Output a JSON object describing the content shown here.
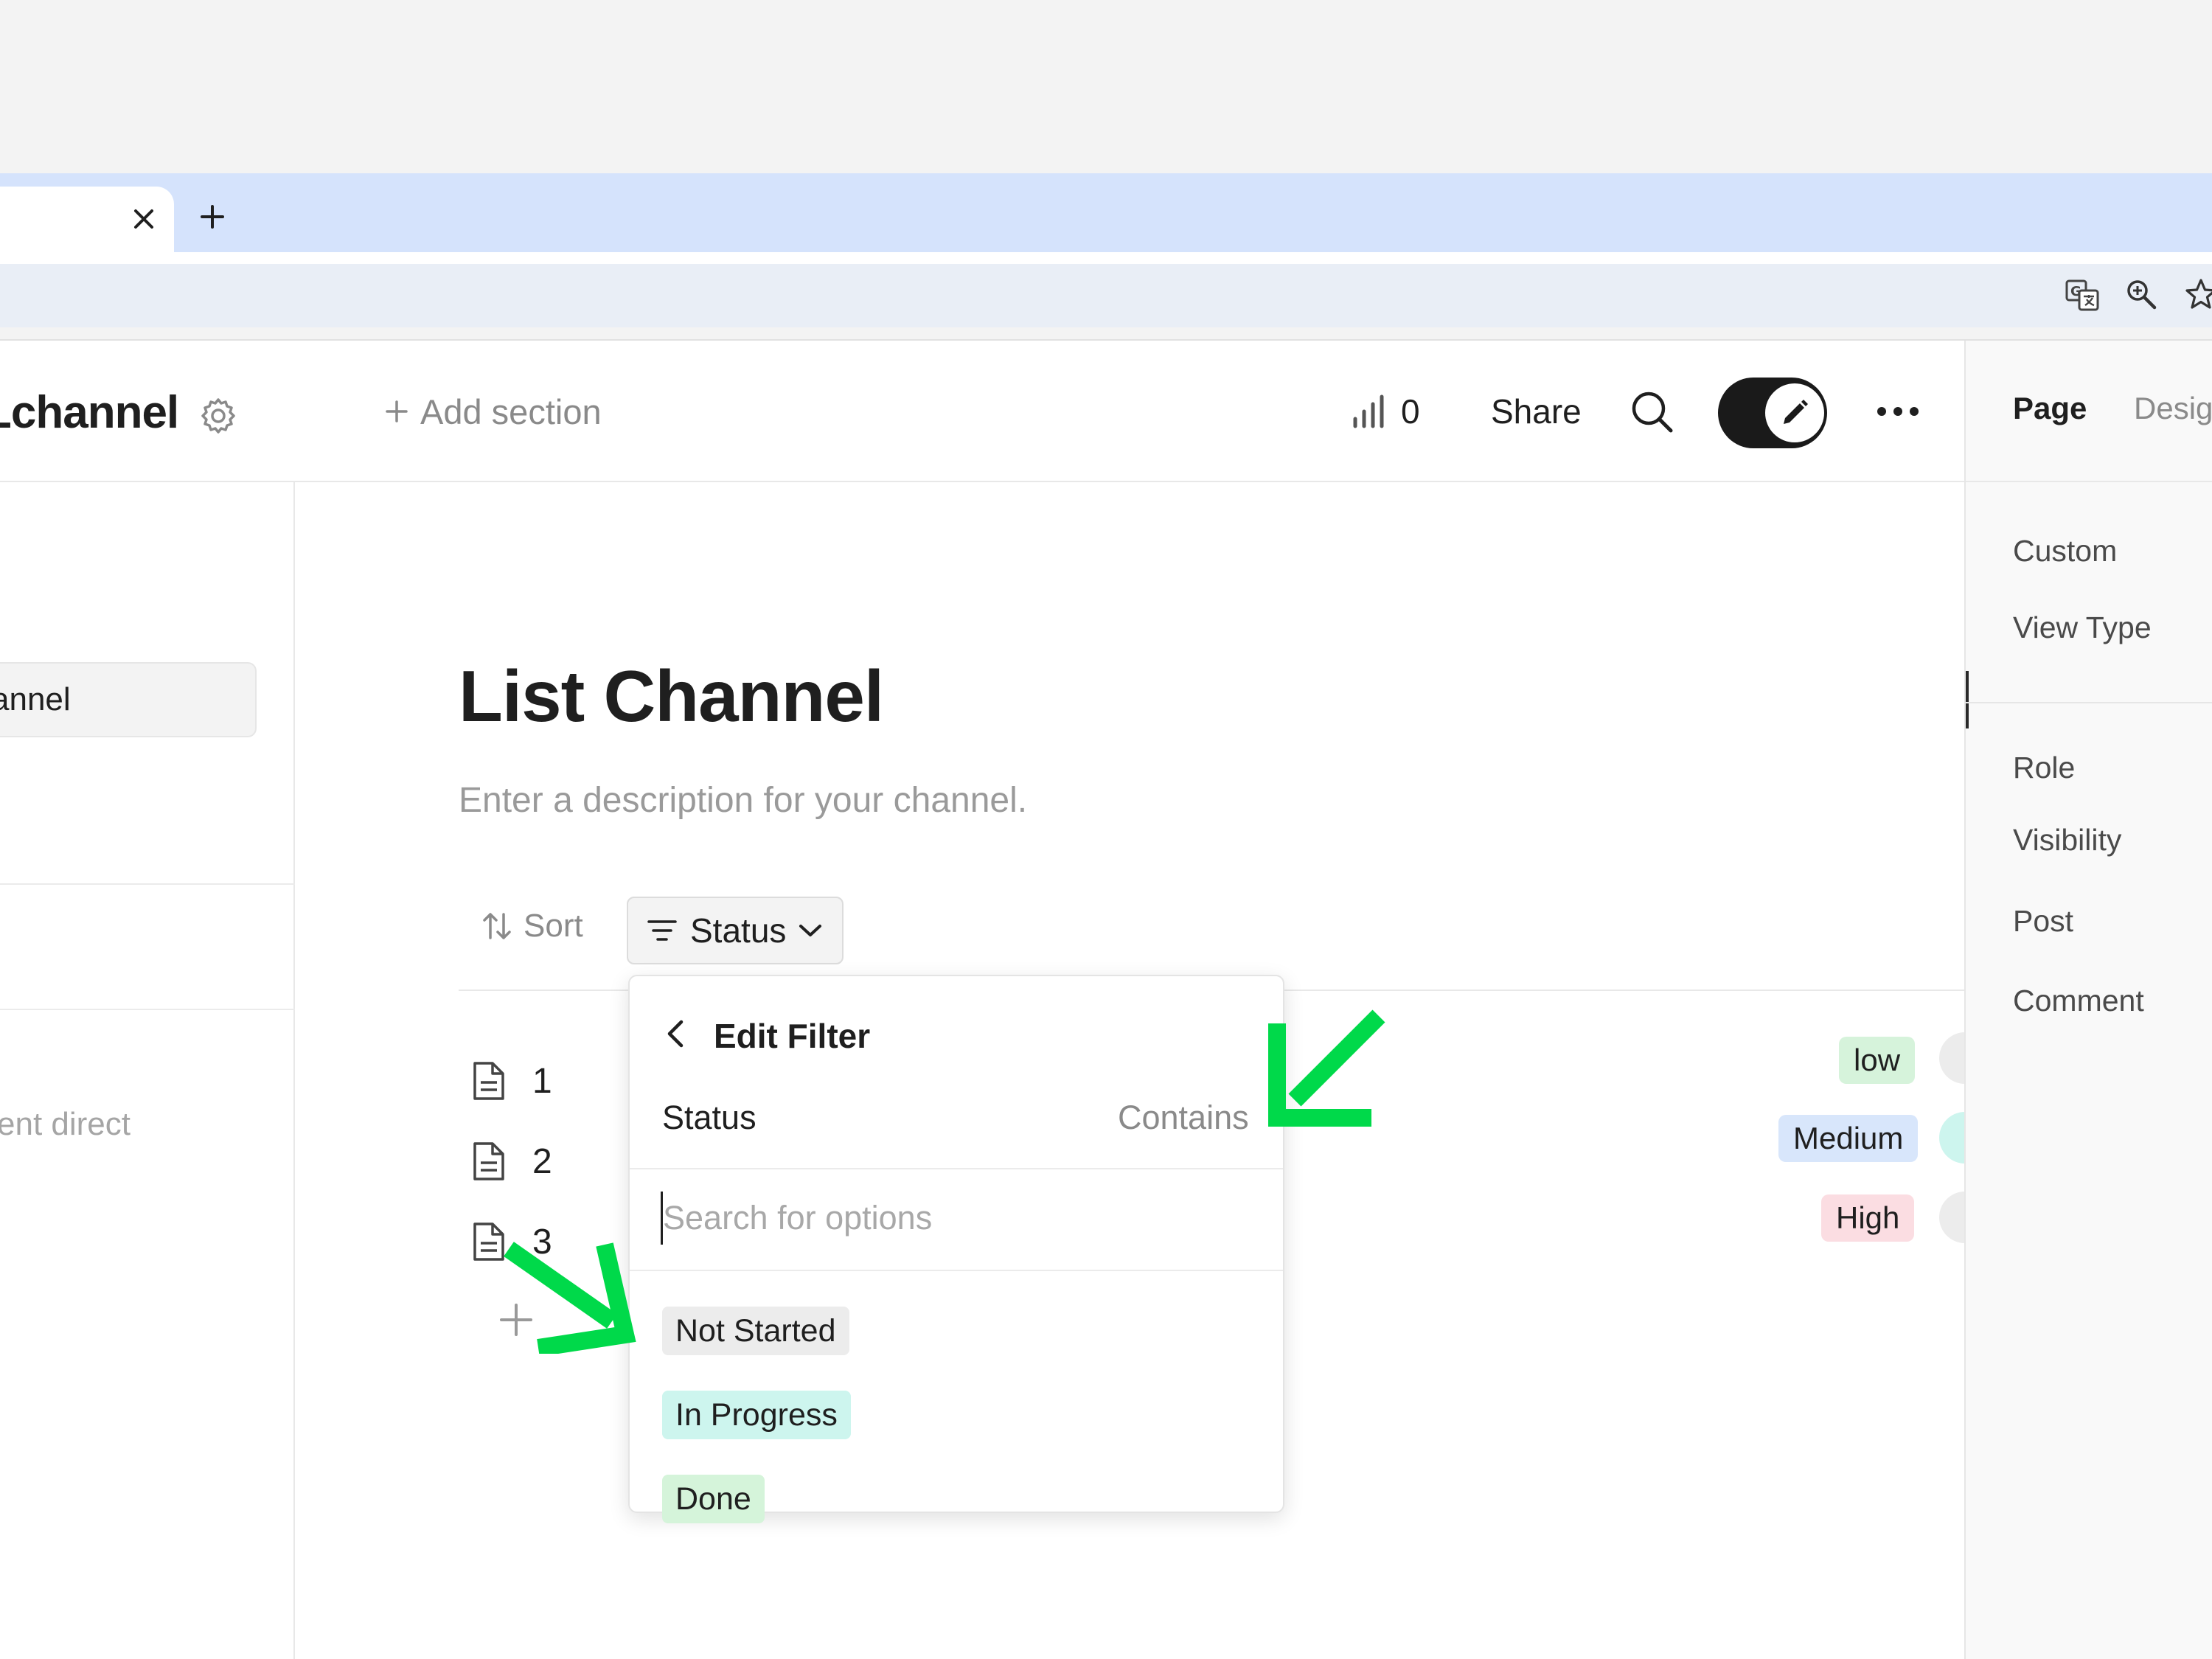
{
  "browser": {
    "tab_close": "×",
    "new_tab": "+"
  },
  "topbar": {
    "workspace_name": "Lchannel",
    "add_section": "Add section",
    "stats_count": "0",
    "share": "Share"
  },
  "sidebar": {
    "active_item": "annel",
    "recent_label": "cent direct"
  },
  "right_panel": {
    "tabs": [
      "Page",
      "Design"
    ],
    "items": [
      "Custom",
      "View Type",
      "Role",
      "Visibility",
      "Post",
      "Comment"
    ]
  },
  "content": {
    "title": "List Channel",
    "description": "Enter a description for your channel.",
    "sort_label": "Sort",
    "filter_label": "Status",
    "rows": [
      {
        "name": "1",
        "priority": "low",
        "priority_color": "#d6f3db"
      },
      {
        "name": "2",
        "priority": "Medium",
        "priority_color": "#d8e6fb"
      },
      {
        "name": "3",
        "priority": "High",
        "priority_color": "#fbdde2"
      }
    ]
  },
  "filter_dropdown": {
    "title": "Edit Filter",
    "field": "Status",
    "operator": "Contains",
    "search_placeholder": "Search for options",
    "options": [
      {
        "label": "Not Started",
        "color": "#ececec"
      },
      {
        "label": "In Progress",
        "color": "#cdf5ee"
      },
      {
        "label": "Done",
        "color": "#d5f4da"
      }
    ]
  },
  "colors": {
    "tabstrip": "#d5e3fc",
    "accent_arrow": "#00d94a",
    "toggle": "#1a1a1a"
  }
}
